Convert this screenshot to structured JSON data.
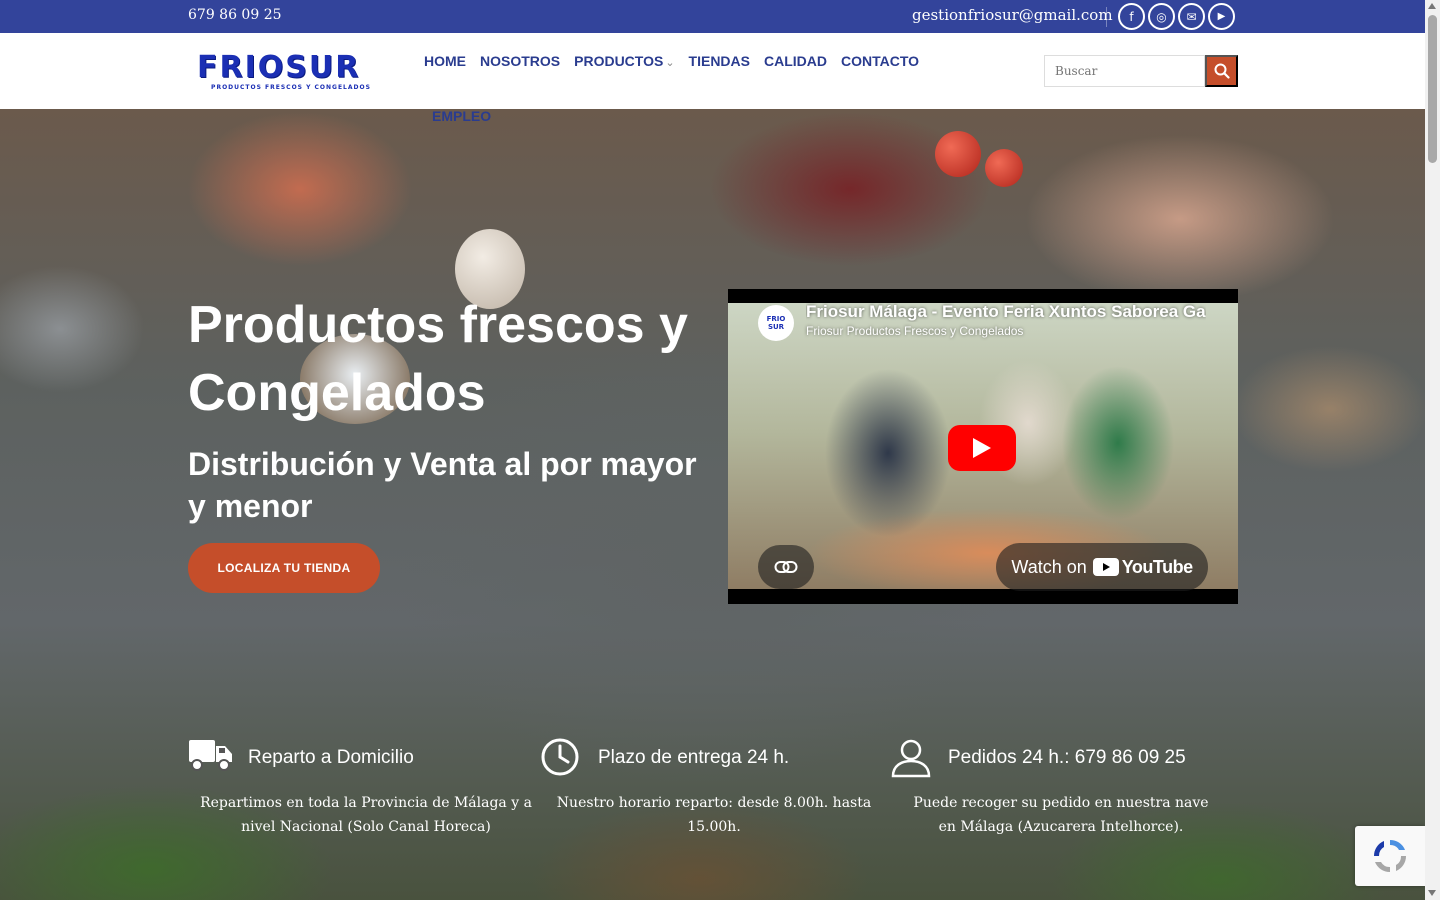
{
  "topbar": {
    "phone": "679 86 09 25",
    "email": "gestionfriosur@gmail.com",
    "social": [
      {
        "icon": "facebook-icon",
        "glyph": "f"
      },
      {
        "icon": "instagram-icon",
        "glyph": "◎"
      },
      {
        "icon": "mail-icon",
        "glyph": "✉"
      },
      {
        "icon": "youtube-icon",
        "glyph": "▶"
      }
    ]
  },
  "header": {
    "logo": {
      "word": "FRIOSUR",
      "tagline": "PRODUCTOS FRESCOS Y CONGELADOS"
    },
    "nav": {
      "home": "HOME",
      "nosotros": "NOSOTROS",
      "productos": "PRODUCTOS",
      "tiendas": "TIENDAS",
      "calidad": "CALIDAD",
      "contacto": "CONTACTO",
      "empleo": "EMPLEO"
    },
    "search": {
      "placeholder": "Buscar"
    }
  },
  "hero": {
    "title": "Productos frescos y Congelados",
    "subtitle": "Distribución y Venta al por mayor y menor",
    "cta": "LOCALIZA TU TIENDA",
    "video": {
      "title": "Friosur Málaga - Evento Feria Xuntos Saborea Ga",
      "channel": "Friosur Productos Frescos y Congelados",
      "channel_avatar": "FRIO SUR",
      "watch_on": "Watch on",
      "youtube": "YouTube"
    }
  },
  "features": [
    {
      "icon": "truck-icon",
      "title": "Reparto a Domicilio",
      "text": "Repartimos en toda la Provincia de Málaga y a nivel Nacional (Solo Canal Horeca)"
    },
    {
      "icon": "clock-icon",
      "title": "Plazo de entrega 24 h.",
      "text": "Nuestro horario reparto: desde 8.00h. hasta 15.00h."
    },
    {
      "icon": "user-icon",
      "title": "Pedidos 24 h.:   679 86 09 25",
      "text": "Puede recoger su pedido en nuestra nave en Málaga (Azucarera Intelhorce)."
    }
  ],
  "colors": {
    "topbar": "#33449b",
    "nav_text": "#2a3c8f",
    "accent": "#c54e2a",
    "youtube_red": "#ff0000"
  }
}
